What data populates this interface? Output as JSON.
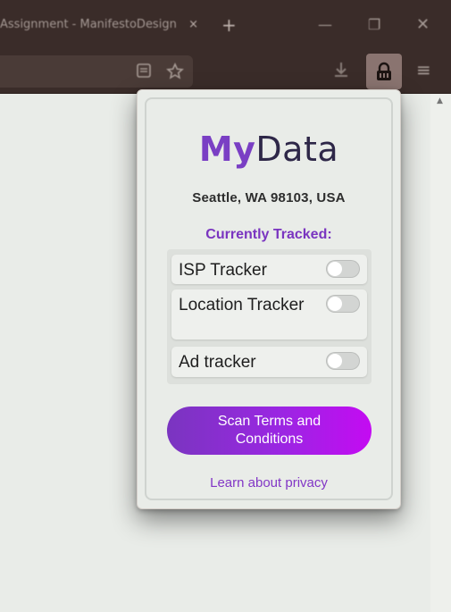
{
  "browser": {
    "tab_title": "Assignment - ManifestoDesign",
    "tab_close": "×",
    "new_tab": "+",
    "window_minimize": "—",
    "window_maximize": "❐",
    "window_close": "✕",
    "menu": "≡"
  },
  "popup": {
    "logo": {
      "my": "My",
      "data": "Data"
    },
    "location": "Seattle, WA 98103, USA",
    "tracked_title": "Currently Tracked:",
    "trackers": [
      {
        "label": "ISP Tracker",
        "enabled": false
      },
      {
        "label": "Location Tracker",
        "enabled": false
      },
      {
        "label": "Ad tracker",
        "enabled": false
      }
    ],
    "scan_button": "Scan Terms and Conditions",
    "learn_link": "Learn about privacy"
  },
  "colors": {
    "brand_purple": "#7a3fc4",
    "logo_dark": "#2e2748",
    "button_gradient_start": "#7a35c0",
    "button_gradient_end": "#c40bf2",
    "chrome_dark": "#3a2c29"
  },
  "icons": {
    "reader": "reader-view-icon",
    "bookmark": "star-icon",
    "download": "download-icon",
    "extension": "lock-icon",
    "menu": "hamburger-menu-icon"
  }
}
